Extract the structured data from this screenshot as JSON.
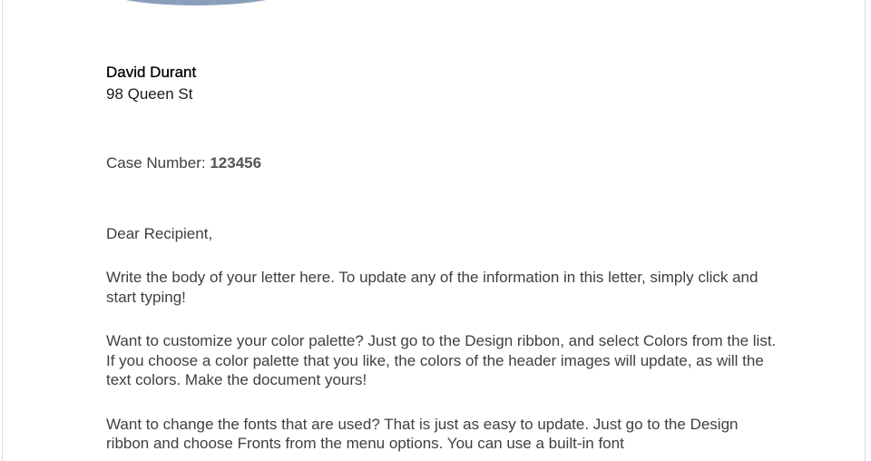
{
  "sender": {
    "name": "David Durant",
    "address": "98 Queen St"
  },
  "case": {
    "label": "Case Number: ",
    "number": "123456"
  },
  "letter": {
    "salutation": "Dear Recipient,",
    "paragraphs": [
      "Write the body of your letter here.  To update any of the information in this letter, simply click and start typing!",
      "Want to customize your color palette?  Just go to the Design ribbon, and select Colors from the list.  If you choose a color palette that you like, the colors of the header images will update, as will the text colors.  Make the document yours!",
      "Want to change the fonts that are used?  That is just as easy to update.  Just go to the Design ribbon and choose Fronts from the menu options.  You can use a built-in font"
    ]
  },
  "colors": {
    "header_accent": "#8a9fba",
    "body_text": "#404040"
  }
}
